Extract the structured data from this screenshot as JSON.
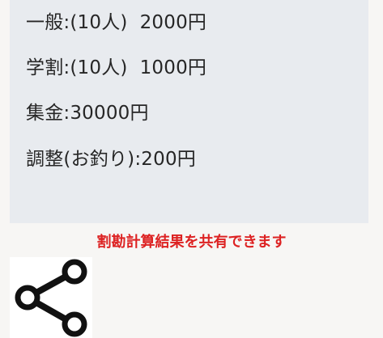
{
  "results": {
    "general": "一般:(10人)  2000円",
    "student": "学割:(10人)  1000円",
    "collected": "集金:30000円",
    "adjustment": "調整(お釣り):200円"
  },
  "share": {
    "caption": "割勘計算結果を共有できます",
    "icon": "share-icon"
  },
  "colors": {
    "panel_background": "#e8ebef",
    "caption_red": "#dd2222",
    "icon_black": "#111111"
  }
}
